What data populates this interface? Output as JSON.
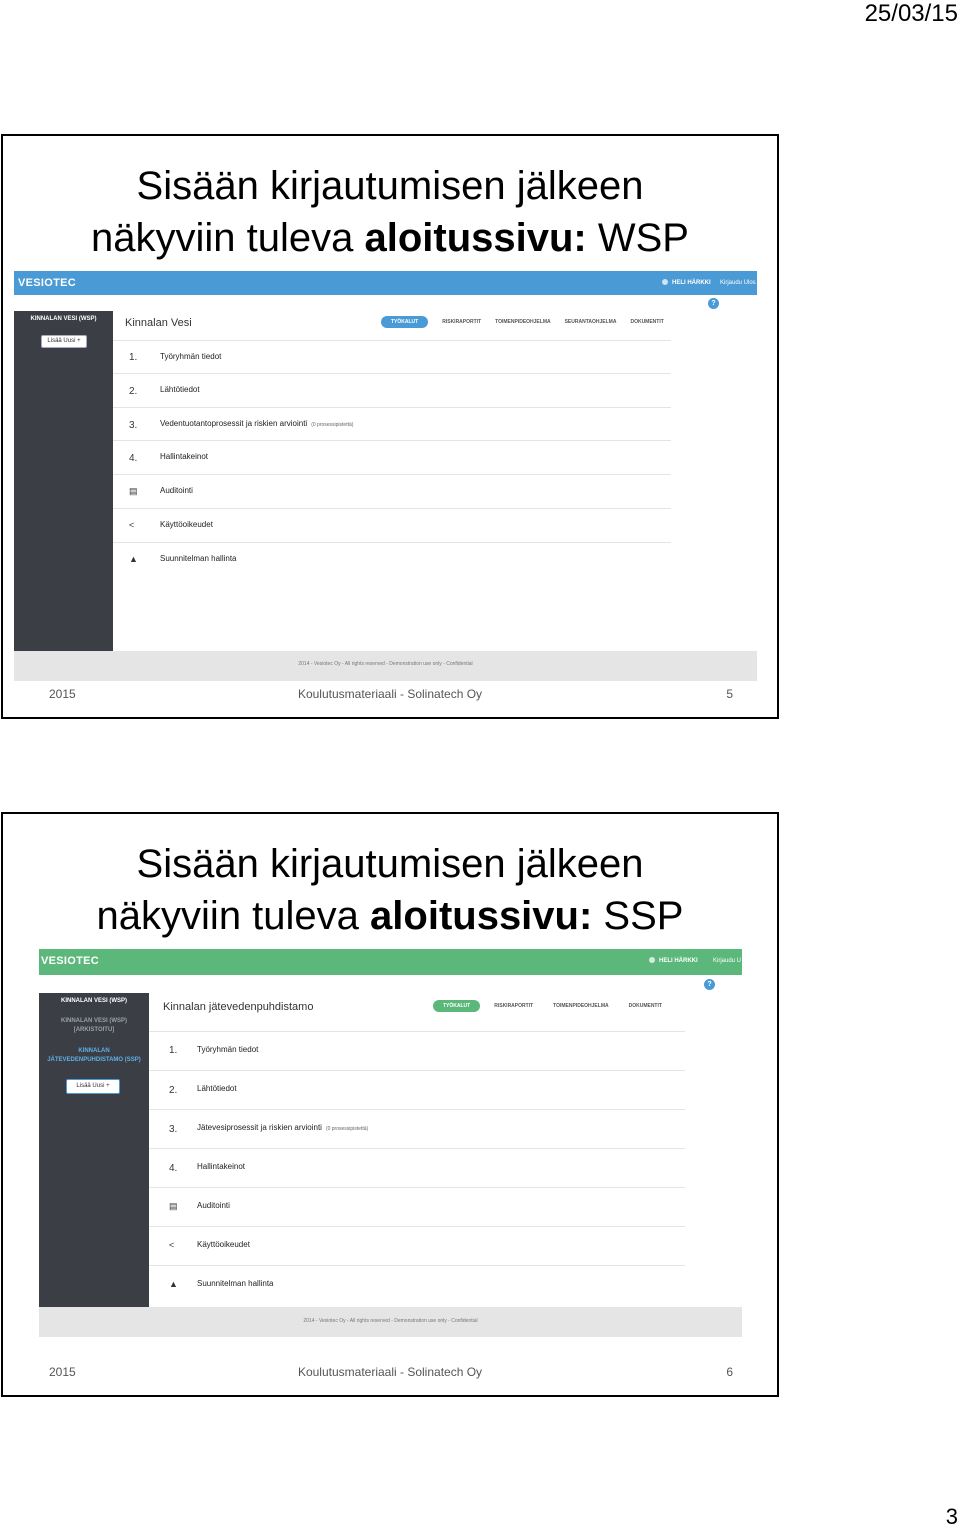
{
  "header_date": "25/03/15",
  "page_number": "3",
  "slides": [
    {
      "title_pre": "Sisään kirjautumisen jälkeen näkyviin tuleva ",
      "title_bold": "aloitussivu:",
      "title_post": " WSP",
      "app": {
        "accent": "#4a9ad6",
        "brand": "VESIOTEC",
        "user": "HELI HÄRKKI",
        "logout": "Kirjaudu Ulos",
        "help": "?",
        "sidebar_items": [
          "KINNALAN VESI (WSP)"
        ],
        "add_button": "Lisää Uusi +",
        "project_name": "Kinnalan Vesi",
        "tabs": [
          "TYÖKALUT",
          "RISKIRAPORTIT",
          "TOIMENPIDEOHJELMA",
          "SEURANTAOHJELMA",
          "DOKUMENTIT"
        ],
        "rows": [
          {
            "marker": "1.",
            "label": "Työryhmän tiedot",
            "sub": ""
          },
          {
            "marker": "2.",
            "label": "Lähtötiedot",
            "sub": ""
          },
          {
            "marker": "3.",
            "label": "Vedentuotantoprosessit ja riskien arviointi",
            "sub": "(0 prosessipistettä)"
          },
          {
            "marker": "4.",
            "label": "Hallintakeinot",
            "sub": ""
          },
          {
            "marker": "▤",
            "label": "Auditointi",
            "sub": ""
          },
          {
            "marker": "<",
            "label": "Käyttöoikeudet",
            "sub": ""
          },
          {
            "marker": "▲",
            "label": "Suunnitelman hallinta",
            "sub": ""
          }
        ],
        "footer": "2014 - Vesiotec Oy - All rights reserved - Demonstration use only - Confidential"
      },
      "footer_year": "2015",
      "footer_center": "Koulutusmateriaali - Solinatech Oy",
      "footer_num": "5"
    },
    {
      "title_pre": "Sisään kirjautumisen jälkeen näkyviin tuleva ",
      "title_bold": "aloitussivu:",
      "title_post": " SSP",
      "app": {
        "accent": "#5cb87a",
        "brand": "VESIOTEC",
        "user": "HELI HÄRKKI",
        "logout": "Kirjaudu U",
        "help": "?",
        "sidebar_items": [
          "KINNALAN VESI (WSP)",
          "KINNALAN VESI (WSP) [ARKISTOITU]",
          "KINNALAN JÄTEVEDENPUHDISTAMO (SSP)"
        ],
        "add_button": "Lisää Uusi +",
        "project_name": "Kinnalan jätevedenpuhdistamo",
        "tabs": [
          "TYÖKALUT",
          "RISKIRAPORTIT",
          "TOIMENPIDEOHJELMA",
          "DOKUMENTIT"
        ],
        "rows": [
          {
            "marker": "1.",
            "label": "Työryhmän tiedot",
            "sub": ""
          },
          {
            "marker": "2.",
            "label": "Lähtötiedot",
            "sub": ""
          },
          {
            "marker": "3.",
            "label": "Jätevesiprosessit ja riskien arviointi",
            "sub": "(0 prosessipistettä)"
          },
          {
            "marker": "4.",
            "label": "Hallintakeinot",
            "sub": ""
          },
          {
            "marker": "▤",
            "label": "Auditointi",
            "sub": ""
          },
          {
            "marker": "<",
            "label": "Käyttöoikeudet",
            "sub": ""
          },
          {
            "marker": "▲",
            "label": "Suunnitelman hallinta",
            "sub": ""
          }
        ],
        "footer": "2014 - Vesiotec Oy - All rights reserved - Demonstration use only - Confidential"
      },
      "footer_year": "2015",
      "footer_center": "Koulutusmateriaali - Solinatech Oy",
      "footer_num": "6"
    }
  ]
}
